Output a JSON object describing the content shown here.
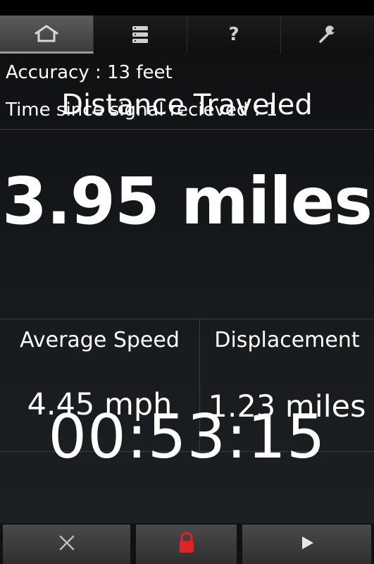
{
  "tabs": [
    {
      "icon": "home-icon",
      "active": true
    },
    {
      "icon": "list-icon",
      "active": false
    },
    {
      "icon": "help-icon",
      "glyph": "?",
      "active": false
    },
    {
      "icon": "wrench-icon",
      "active": false
    }
  ],
  "status": {
    "accuracy": "Accuracy : 13 feet",
    "signal": "Time since signal recieved : 1"
  },
  "distance": {
    "title": "Distance Traveled",
    "value": "3.95 miles"
  },
  "average_speed": {
    "title": "Average Speed",
    "value": "4.45 mph"
  },
  "displacement": {
    "title": "Displacement",
    "value": "1.23 miles"
  },
  "timer": "00:53:15",
  "controls": [
    {
      "icon": "close-icon"
    },
    {
      "icon": "lock-icon",
      "color": "#e0222a"
    },
    {
      "icon": "play-icon"
    }
  ],
  "colors": {
    "background": "#000000",
    "text": "#ffffff",
    "active_tab": "#555555",
    "lock": "#e0222a"
  }
}
